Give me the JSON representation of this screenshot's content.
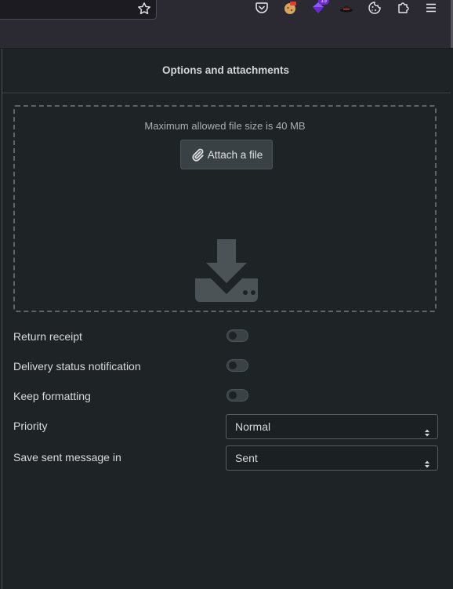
{
  "browser": {
    "extension_badges": {
      "purple_count": "15"
    }
  },
  "panel": {
    "title": "Options and attachments",
    "max_size_text": "Maximum allowed file size is 40 MB",
    "attach_label": "Attach a file"
  },
  "options": {
    "return_receipt": {
      "label": "Return receipt",
      "enabled": false
    },
    "delivery_status": {
      "label": "Delivery status notification",
      "enabled": false
    },
    "keep_formatting": {
      "label": "Keep formatting",
      "enabled": false
    },
    "priority": {
      "label": "Priority",
      "value": "Normal"
    },
    "save_sent": {
      "label": "Save sent message in",
      "value": "Sent"
    }
  },
  "colors": {
    "background": "#1e2325",
    "toolbar": "#2b2a33",
    "accent_purple": "#6d28d9"
  }
}
